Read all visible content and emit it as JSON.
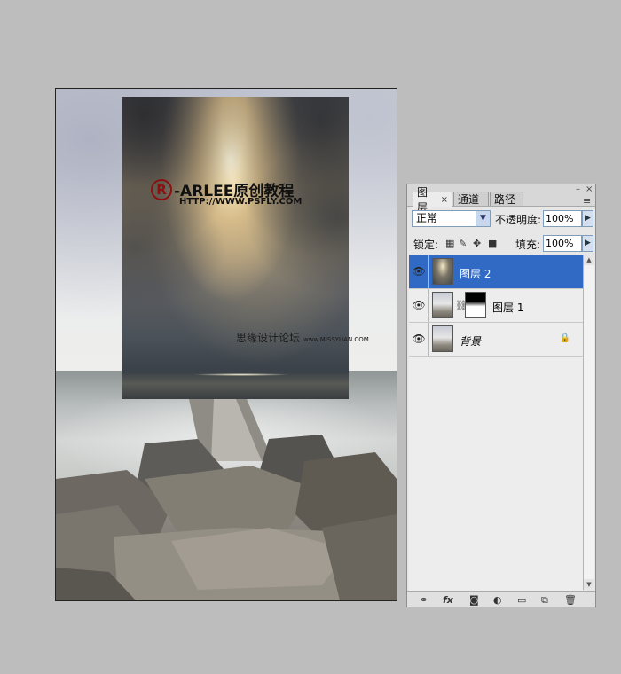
{
  "canvas": {
    "watermark_logo_symbol": "R",
    "watermark_logo_text": "-ARLEE原创教程",
    "watermark_url": "HTTP://WWW.PSFLY.COM",
    "watermark_bottom_cn": "思缘设计论坛",
    "watermark_bottom_en": "www.MISSYUAN.COM"
  },
  "layers_panel": {
    "tabs": [
      {
        "label": "图层",
        "active": true,
        "close": "×"
      },
      {
        "label": "通道",
        "active": false
      },
      {
        "label": "路径",
        "active": false
      }
    ],
    "panel_close_icon": "×",
    "panel_minimize_icon": "–",
    "panel_menu_icon": "≡",
    "blend_mode": "正常",
    "opacity_label": "不透明度:",
    "opacity_value": "100%",
    "lock_label": "锁定:",
    "fill_label": "填充:",
    "fill_value": "100%",
    "layers": [
      {
        "name": "图层 2",
        "selected": true,
        "visible": true
      },
      {
        "name": "图层 1",
        "selected": false,
        "visible": true,
        "has_mask": true
      },
      {
        "name": "背景",
        "selected": false,
        "visible": true,
        "locked": true
      }
    ],
    "footer_icons": [
      "link-icon",
      "fx-icon",
      "mask-icon",
      "adjustment-icon",
      "group-icon",
      "new-layer-icon",
      "trash-icon"
    ],
    "footer_labels": {
      "fx": "fx"
    }
  }
}
